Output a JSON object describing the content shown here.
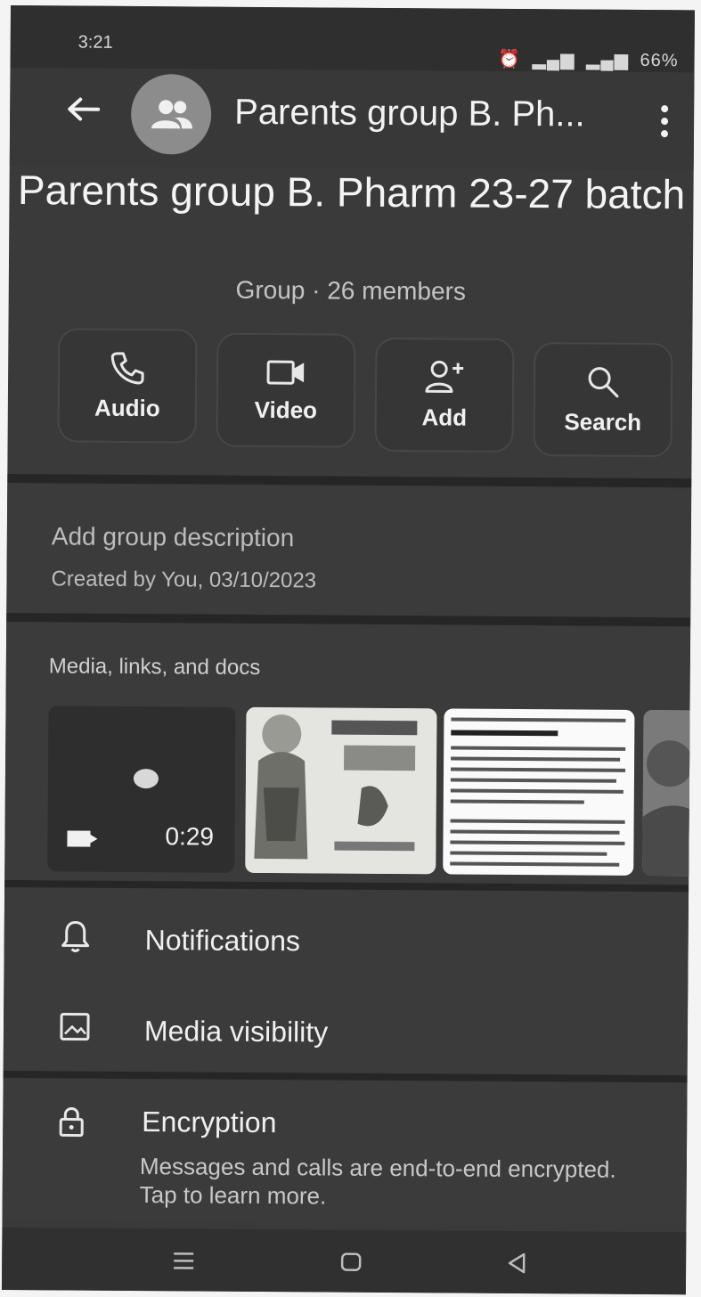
{
  "status_bar": {
    "time": "3:21",
    "battery": "66%"
  },
  "header": {
    "title": "Parents group B. Ph..."
  },
  "group": {
    "name": "Parents group B. Pharm 23-27 batch",
    "subtitle": "Group · 26 members"
  },
  "actions": [
    {
      "label": "Audio",
      "icon": "phone-icon"
    },
    {
      "label": "Video",
      "icon": "video-camera-icon"
    },
    {
      "label": "Add",
      "icon": "add-person-icon"
    },
    {
      "label": "Search",
      "icon": "search-icon"
    }
  ],
  "description": {
    "add_label": "Add group description",
    "created": "Created by You, 03/10/2023"
  },
  "media": {
    "title": "Media, links, and docs",
    "video_duration": "0:29"
  },
  "settings": {
    "notifications": "Notifications",
    "media_visibility": "Media visibility"
  },
  "encryption": {
    "title": "Encryption",
    "text": "Messages and calls are end-to-end encrypted. Tap to learn more."
  },
  "colors": {
    "background": "#3a3a3a",
    "text": "#f1f1f1",
    "secondary_text": "#bdbdbd"
  }
}
